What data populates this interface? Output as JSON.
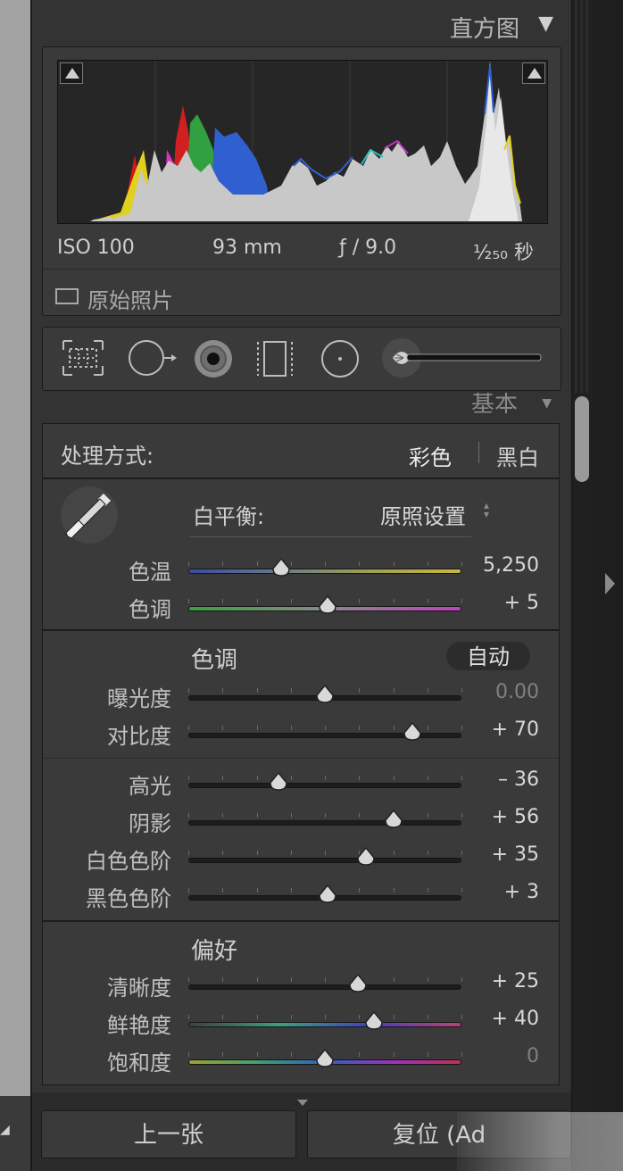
{
  "histogram": {
    "title": "直方图",
    "iso": "ISO 100",
    "focal": "93 mm",
    "aperture": "ƒ / 9.0",
    "shutter": "¹⁄₂₅₀ 秒",
    "original_photo": "原始照片"
  },
  "panel": {
    "title": "基本"
  },
  "treatment": {
    "label": "处理方式:",
    "color": "彩色",
    "bw": "黑白"
  },
  "white_balance": {
    "label": "白平衡:",
    "value": "原照设置",
    "sliders": [
      {
        "name": "色温",
        "value": "5,250",
        "position": 0.34,
        "track": "temp"
      },
      {
        "name": "色调",
        "value": "+ 5",
        "position": 0.51,
        "track": "tint"
      }
    ]
  },
  "tone": {
    "title": "色调",
    "auto": "自动",
    "sliders_a": [
      {
        "name": "曝光度",
        "value": "0.00",
        "position": 0.5,
        "dim": true
      },
      {
        "name": "对比度",
        "value": "+ 70",
        "position": 0.82
      }
    ],
    "sliders_b": [
      {
        "name": "高光",
        "value": "– 36",
        "position": 0.33
      },
      {
        "name": "阴影",
        "value": "+ 56",
        "position": 0.75
      },
      {
        "name": "白色色阶",
        "value": "+ 35",
        "position": 0.65
      },
      {
        "name": "黑色色阶",
        "value": "+ 3",
        "position": 0.51
      }
    ]
  },
  "presence": {
    "title": "偏好",
    "sliders": [
      {
        "name": "清晰度",
        "value": "+ 25",
        "position": 0.62
      },
      {
        "name": "鲜艳度",
        "value": "+ 40",
        "position": 0.68,
        "track": "vib"
      },
      {
        "name": "饱和度",
        "value": "0",
        "position": 0.5,
        "track": "sat",
        "dim": true
      }
    ]
  },
  "buttons": {
    "prev": "上一张",
    "reset": "复位 (Ad"
  }
}
